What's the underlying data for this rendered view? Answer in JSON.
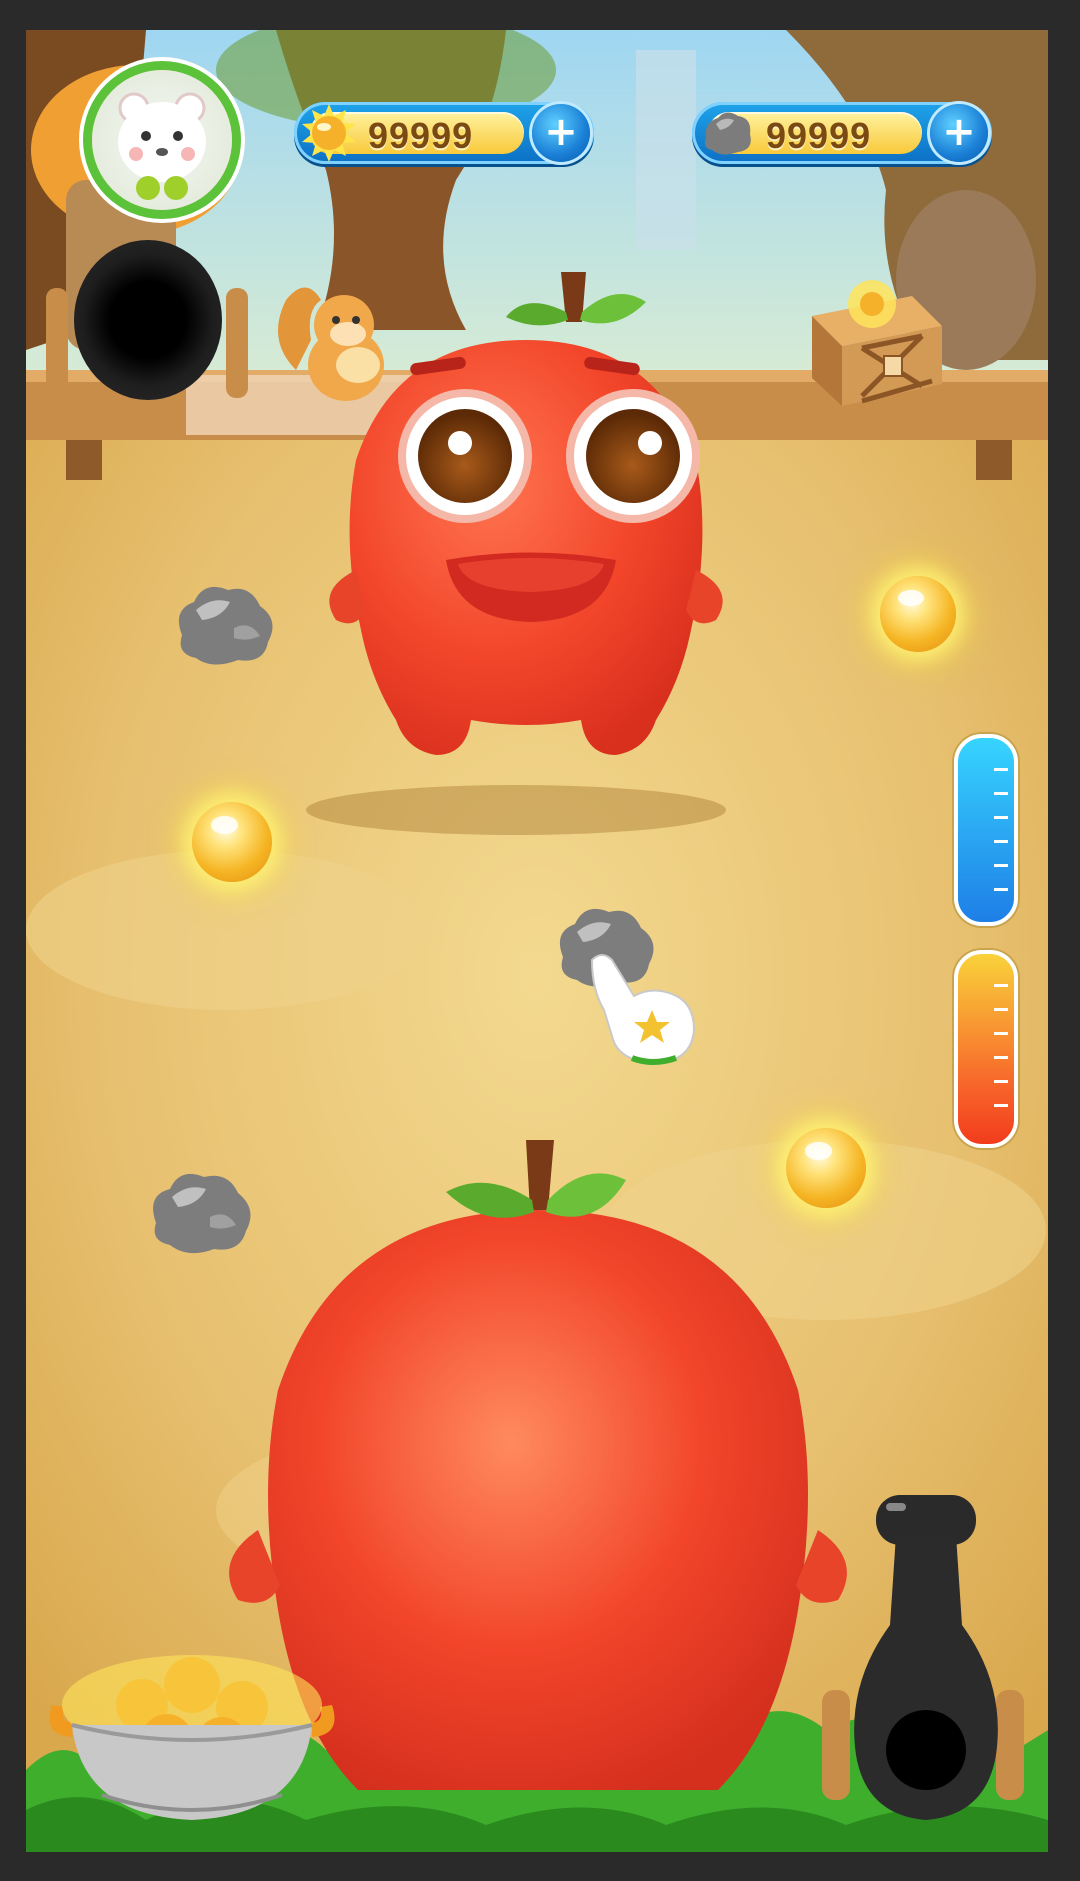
{
  "hud": {
    "sun_currency": {
      "value": "99999",
      "add_label": "+"
    },
    "stone_currency": {
      "value": "99999",
      "add_label": "+"
    }
  },
  "icons": {
    "avatar": "polar-bear-avatar-icon",
    "sun": "sun-coin-icon",
    "stone": "stone-icon",
    "tap_hint": "pointing-glove-icon"
  },
  "gauges": {
    "water": {
      "level": 1.0,
      "color": "#2b9ef2"
    },
    "heat": {
      "level": 1.0,
      "color": "#f7642a"
    }
  },
  "colors": {
    "fruit_body": "#f2452a",
    "sun_glow": "#ffe45a",
    "hud_blue": "#1a8fe0",
    "hud_gold": "#f8c93a"
  }
}
